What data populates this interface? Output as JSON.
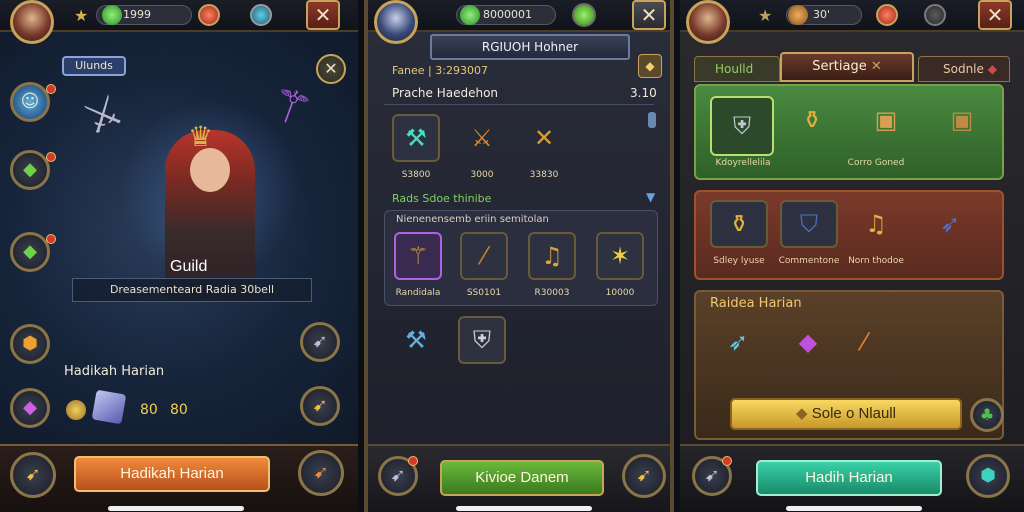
{
  "left": {
    "currency_value": "1999",
    "badge_label": "Ulunds",
    "hero_name": "Guild",
    "hero_desc": "Dreasementeard Radia 30bell",
    "daily_title": "Hadikah Harian",
    "reward_a": "80",
    "reward_b": "80",
    "claim_button": "Hadikah Harian"
  },
  "middle": {
    "currency_value": "8000001",
    "header_title": "RGIUOH Hohner",
    "subtitle": "Fanee | 3:293007",
    "row_label": "Prache Haedehon",
    "row_value": "3.10",
    "items_top": [
      {
        "icon": "cannon-icon",
        "caption": "S3800"
      },
      {
        "icon": "sword-icon",
        "caption": "3000"
      },
      {
        "icon": "crossbow-icon",
        "caption": "33830"
      }
    ],
    "section_label": "Rads Sdoe thinibe",
    "section_sub": "Nienenensemb eriin semitolan",
    "items_mid": [
      {
        "icon": "staff-icon",
        "caption": "Randidala"
      },
      {
        "icon": "spear-icon",
        "caption": "SS0101"
      },
      {
        "icon": "bell-icon",
        "caption": "R30003"
      },
      {
        "icon": "star-icon",
        "caption": "10000"
      }
    ],
    "confirm_button": "Kivioe Danem"
  },
  "right": {
    "currency_value": "30'",
    "tabs": [
      "Houlld",
      "Sertiage",
      "Sodnle"
    ],
    "section1_caption_a": "Kdoyrellelila",
    "section1_caption_b": "Corro Goned",
    "section2_captions": [
      "Sdley lyuse",
      "Commentone",
      "Norn thodoe"
    ],
    "section3_title": "Raidea Harian",
    "sale_button": "Sole o Nlaull",
    "claim_button": "Hadih Harian"
  },
  "colors": {
    "gold": "#c9a35a",
    "orange_btn": "#d9692a",
    "green_btn": "#4f9a2e",
    "teal_btn": "#1fa58a",
    "green_panel": "#3f7a38",
    "red_panel": "#8a3b2c",
    "brown_panel": "#5b4028"
  }
}
